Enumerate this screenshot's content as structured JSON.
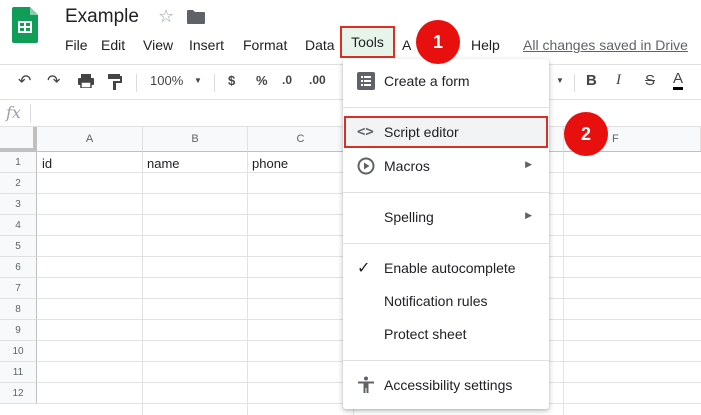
{
  "doc": {
    "title": "Example",
    "saved_status": "All changes saved in Drive"
  },
  "menu": {
    "file": "File",
    "edit": "Edit",
    "view": "View",
    "insert": "Insert",
    "format": "Format",
    "data": "Data",
    "tools": "Tools",
    "addons": "A",
    "help": "Help"
  },
  "toolbar": {
    "zoom": "100%",
    "currency": "$",
    "percent": "%",
    "dec_less": ".0",
    "dec_more": ".00",
    "bold": "B",
    "italic": "I",
    "strike": "S",
    "text_color": "A"
  },
  "formula_bar": {
    "fx": "fx"
  },
  "grid": {
    "columns": [
      "A",
      "B",
      "C",
      "F"
    ],
    "rows": [
      "1",
      "2",
      "3",
      "4",
      "5",
      "6",
      "7",
      "8",
      "9",
      "10",
      "11",
      "12"
    ],
    "row1": {
      "a": "id",
      "b": "name",
      "c": "phone"
    }
  },
  "tools_menu": {
    "create_form": "Create a form",
    "script_editor": "Script editor",
    "macros": "Macros",
    "spelling": "Spelling",
    "autocomplete": "Enable autocomplete",
    "notification_rules": "Notification rules",
    "protect_sheet": "Protect sheet",
    "accessibility": "Accessibility settings",
    "submenu_arrow": "▶"
  },
  "steps": {
    "one": "1",
    "two": "2"
  },
  "colors": {
    "sheets_green": "#0f9d58",
    "badge_red": "#e8100f",
    "highlight_red": "#d93025"
  }
}
